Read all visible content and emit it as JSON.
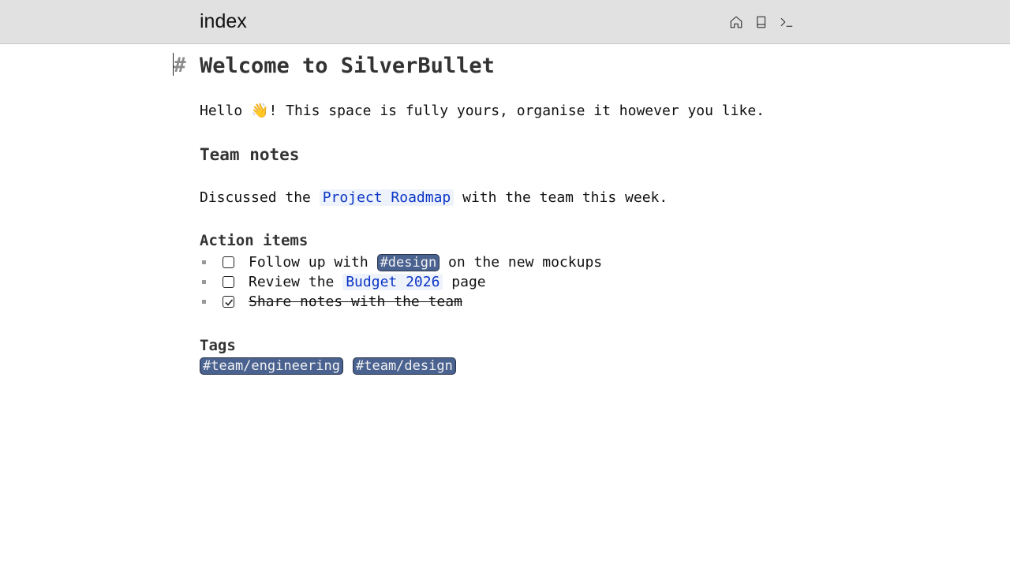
{
  "page": {
    "name": "index"
  },
  "toolbar": {
    "icons": [
      "home-icon",
      "book-icon",
      "terminal-icon"
    ]
  },
  "document": {
    "h1_mark": "#",
    "title": "Welcome to SilverBullet",
    "hello_before": "Hello ",
    "hello_emoji": "👋",
    "hello_after": "! This space is fully yours, organise it however you like.",
    "team_heading": "Team notes",
    "discuss_before": "Discussed the ",
    "discuss_link": "Project Roadmap",
    "discuss_after": " with the team this week.",
    "actions_heading": "Action items",
    "tasks": [
      {
        "before": "Follow up with ",
        "tag": "#design",
        "after": " on the new mockups",
        "done": false
      },
      {
        "before": "Review the ",
        "link": "Budget 2026",
        "after": " page",
        "done": false
      },
      {
        "text": "Share notes with the team",
        "done": true
      }
    ],
    "tags_heading": "Tags",
    "tags": [
      "#team/engineering",
      "#team/design"
    ]
  },
  "colors": {
    "link": "#0a35c5",
    "hashtag_bg": "#4a6290",
    "topbar_bg": "#e1e1e1"
  }
}
